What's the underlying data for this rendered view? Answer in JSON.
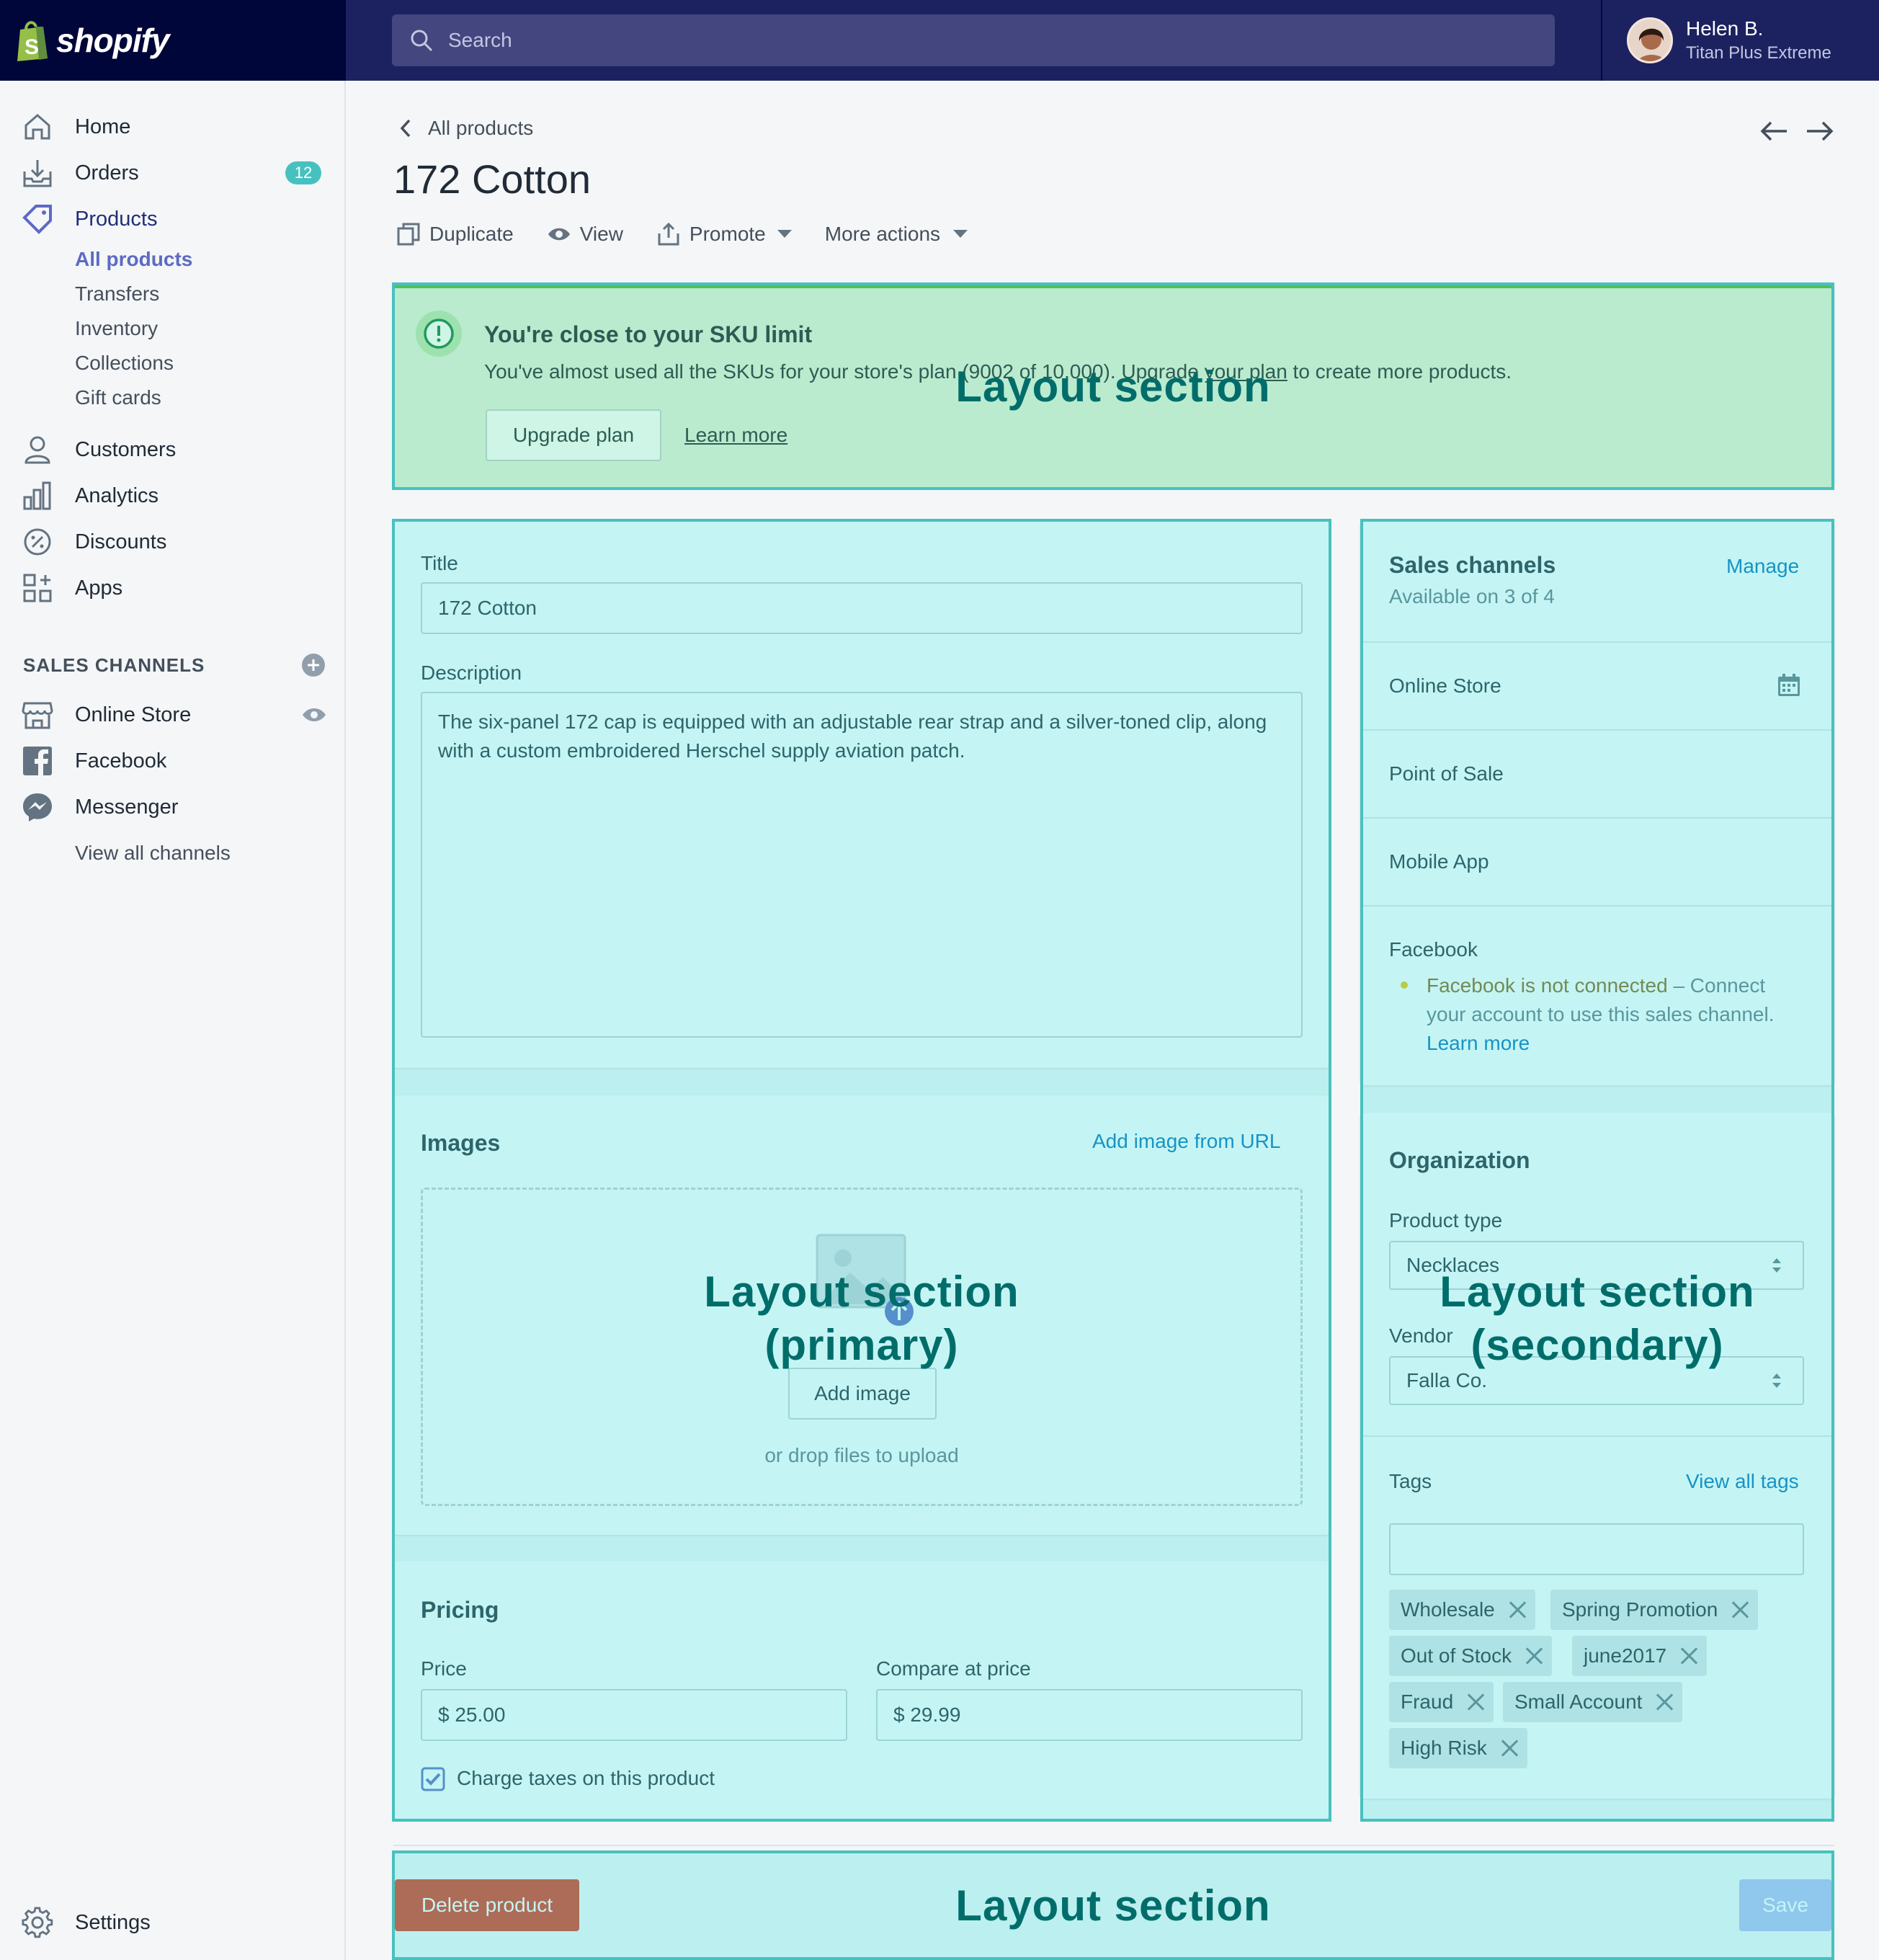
{
  "topbar": {
    "logo": "shopify",
    "search_placeholder": "Search",
    "user_name": "Helen B.",
    "user_plan": "Titan Plus Extreme"
  },
  "sidebar": {
    "items": [
      {
        "label": "Home",
        "icon": "home-icon"
      },
      {
        "label": "Orders",
        "icon": "orders-icon",
        "badge": "12"
      },
      {
        "label": "Products",
        "icon": "tag-icon"
      },
      {
        "label": "Customers",
        "icon": "customer-icon"
      },
      {
        "label": "Analytics",
        "icon": "analytics-icon"
      },
      {
        "label": "Discounts",
        "icon": "discount-icon"
      },
      {
        "label": "Apps",
        "icon": "apps-icon"
      }
    ],
    "product_sub": [
      "All products",
      "Transfers",
      "Inventory",
      "Collections",
      "Gift cards"
    ],
    "sales_channels_heading": "SALES CHANNELS",
    "channels": [
      {
        "label": "Online Store",
        "icon": "store-icon"
      },
      {
        "label": "Facebook",
        "icon": "facebook-icon"
      },
      {
        "label": "Messenger",
        "icon": "messenger-icon"
      }
    ],
    "view_all_channels": "View all channels",
    "settings": "Settings"
  },
  "page": {
    "breadcrumb": "All products",
    "title": "172 Cotton",
    "actions": [
      "Duplicate",
      "View",
      "Promote",
      "More actions"
    ]
  },
  "banner": {
    "title": "You're close to your  SKU limit",
    "body_prefix": "You've almost used all the SKUs for your store's plan (9002 of 10,000). Upgrade ",
    "body_link": "your plan",
    "body_suffix": " to create more products.",
    "primary_button": "Upgrade plan",
    "secondary_link": "Learn more"
  },
  "product": {
    "title_label": "Title",
    "title_value": "172 Cotton",
    "description_label": "Description",
    "description_value": "The six-panel 172 cap is equipped with an adjustable rear strap and a silver-toned clip, along with a custom embroidered Herschel supply aviation patch.",
    "images_title": "Images",
    "add_image_url": "Add image from URL",
    "add_image_button": "Add image",
    "drop_hint": "or drop files to upload",
    "pricing_title": "Pricing",
    "price_label": "Price",
    "price_value": "$ 25.00",
    "compare_label": "Compare at price",
    "compare_value": "$ 29.99",
    "taxes_label": "Charge taxes on this product",
    "taxes_checked": true
  },
  "sales_channels": {
    "title": "Sales channels",
    "manage": "Manage",
    "subtitle": "Available on 3 of 4",
    "channels": [
      "Online Store",
      "Point of Sale",
      "Mobile App",
      "Facebook"
    ],
    "facebook_warning": "Facebook is not connected",
    "facebook_note_1": " – Connect",
    "facebook_note_2": "your account to use this sales channel.",
    "facebook_learn_more": "Learn more"
  },
  "organization": {
    "title": "Organization",
    "product_type_label": "Product type",
    "product_type_value": "Necklaces",
    "vendor_label": "Vendor",
    "vendor_value": "Falla Co.",
    "tags_label": "Tags",
    "view_all_tags": "View all tags",
    "tags": [
      "Wholesale",
      "Spring Promotion",
      "Out of Stock",
      "june2017",
      "Fraud",
      "Small Account",
      "High Risk"
    ]
  },
  "footer": {
    "delete_button": "Delete product",
    "save_button": "Save"
  },
  "overlays": {
    "top": "Layout section",
    "primary_1": "Layout section",
    "primary_2": "(primary)",
    "secondary_1": "Layout section",
    "secondary_2": "(secondary)",
    "bottom": "Layout section"
  },
  "colors": {
    "topbar": "#1c2260",
    "logo_area": "#000639",
    "accent": "#5c6ac4",
    "overlay_border": "#47c1bf",
    "delete": "#de3618"
  }
}
